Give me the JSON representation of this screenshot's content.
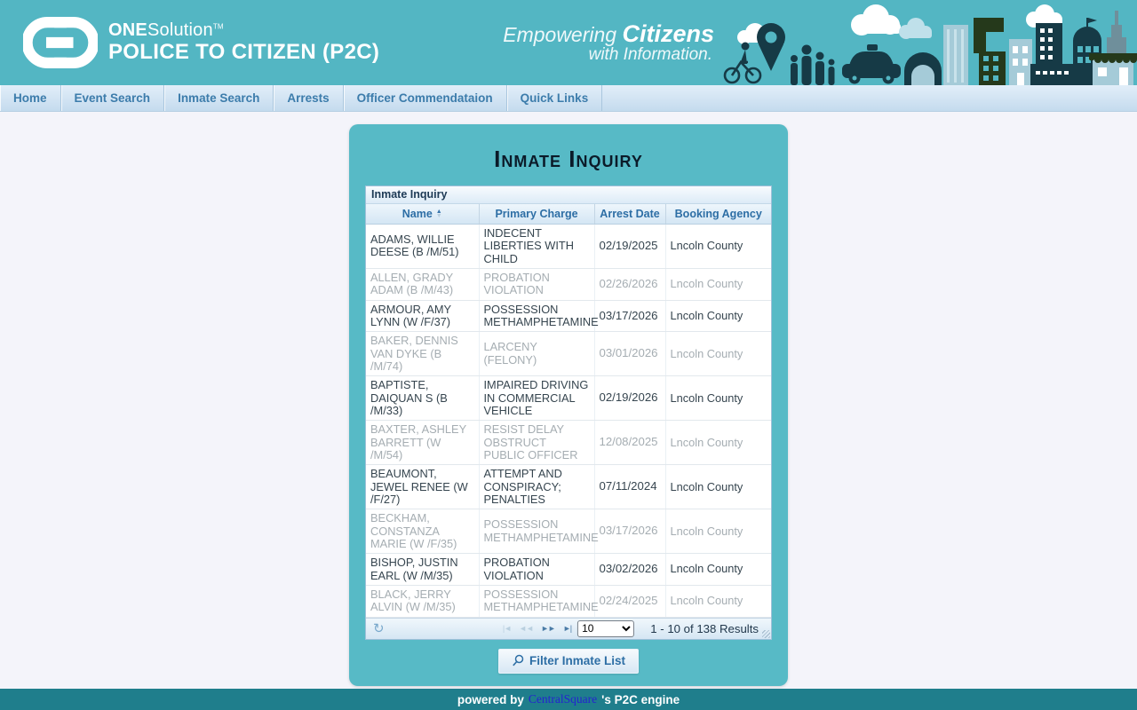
{
  "header": {
    "brand_bold": "ONE",
    "brand_rest": "Solution",
    "brand_tm": "TM",
    "product_title": "POLICE TO CITIZEN (P2C)",
    "tagline_word1": "Empowering",
    "tagline_word2": "Citizens",
    "tagline_line2": "with Information."
  },
  "nav": {
    "items": [
      {
        "label": "Home"
      },
      {
        "label": "Event Search"
      },
      {
        "label": "Inmate Search"
      },
      {
        "label": "Arrests"
      },
      {
        "label": "Officer Commendataion"
      },
      {
        "label": "Quick Links"
      }
    ]
  },
  "main": {
    "page_title": "Inmate Inquiry",
    "table": {
      "caption": "Inmate Inquiry",
      "columns": [
        {
          "label": "Name",
          "sorted": true
        },
        {
          "label": "Primary Charge"
        },
        {
          "label": "Arrest Date"
        },
        {
          "label": "Booking Agency"
        }
      ],
      "rows": [
        {
          "name": "ADAMS, WILLIE DEESE (B /M/51)",
          "primary_charge": "INDECENT LIBERTIES WITH CHILD",
          "arrest_date": "02/19/2025",
          "booking_agency": "Lncoln County",
          "muted": false
        },
        {
          "name": "ALLEN, GRADY ADAM (B /M/43)",
          "primary_charge": "PROBATION VIOLATION",
          "arrest_date": "02/26/2026",
          "booking_agency": "Lncoln County",
          "muted": true
        },
        {
          "name": "ARMOUR, AMY LYNN (W /F/37)",
          "primary_charge": "POSSESSION METHAMPHETAMINE",
          "arrest_date": "03/17/2026",
          "booking_agency": "Lncoln County",
          "muted": false
        },
        {
          "name": "BAKER, DENNIS VAN DYKE (B /M/74)",
          "primary_charge": "LARCENY (FELONY)",
          "arrest_date": "03/01/2026",
          "booking_agency": "Lncoln County",
          "muted": true
        },
        {
          "name": "BAPTISTE, DAIQUAN S (B /M/33)",
          "primary_charge": "IMPAIRED DRIVING IN COMMERCIAL VEHICLE",
          "arrest_date": "02/19/2026",
          "booking_agency": "Lncoln County",
          "muted": false
        },
        {
          "name": "BAXTER, ASHLEY BARRETT (W /M/54)",
          "primary_charge": "RESIST DELAY OBSTRUCT PUBLIC OFFICER",
          "arrest_date": "12/08/2025",
          "booking_agency": "Lncoln County",
          "muted": true
        },
        {
          "name": "BEAUMONT, JEWEL RENEE (W /F/27)",
          "primary_charge": "ATTEMPT AND CONSPIRACY; PENALTIES",
          "arrest_date": "07/11/2024",
          "booking_agency": "Lncoln County",
          "muted": false
        },
        {
          "name": "BECKHAM, CONSTANZA MARIE (W /F/35)",
          "primary_charge": "POSSESSION METHAMPHETAMINE",
          "arrest_date": "03/17/2026",
          "booking_agency": "Lncoln County",
          "muted": true
        },
        {
          "name": "BISHOP, JUSTIN EARL (W /M/35)",
          "primary_charge": "PROBATION VIOLATION",
          "arrest_date": "03/02/2026",
          "booking_agency": "Lncoln County",
          "muted": false
        },
        {
          "name": "BLACK, JERRY ALVIN (W /M/35)",
          "primary_charge": "POSSESSION METHAMPHETAMINE",
          "arrest_date": "02/24/2025",
          "booking_agency": "Lncoln County",
          "muted": true
        }
      ],
      "pager": {
        "reload_icon": "↻",
        "nav_icons": [
          {
            "name": "first-page-icon",
            "glyph": "|◄",
            "disabled": true
          },
          {
            "name": "prev-page-icon",
            "glyph": "◄◄",
            "disabled": true
          },
          {
            "name": "next-page-icon",
            "glyph": "►►",
            "disabled": false
          },
          {
            "name": "last-page-icon",
            "glyph": "►|",
            "disabled": false
          }
        ],
        "page_size": "10",
        "status": "1 - 10 of 138 Results"
      }
    },
    "filter_button_label": "Filter Inmate List"
  },
  "footer": {
    "prefix": "powered by",
    "link_label": "CentralSquare",
    "suffix": "'s P2C engine"
  },
  "colors": {
    "header_teal": "#53b6c3",
    "panel_teal": "#57bac6",
    "footer_teal": "#1f7e8c",
    "nav_text_blue": "#3c7cab",
    "grid_header_blue": "#2d6ea5",
    "row_text": "#36454f",
    "row_text_muted": "#a5adb2",
    "link_blue": "#2424cf"
  }
}
